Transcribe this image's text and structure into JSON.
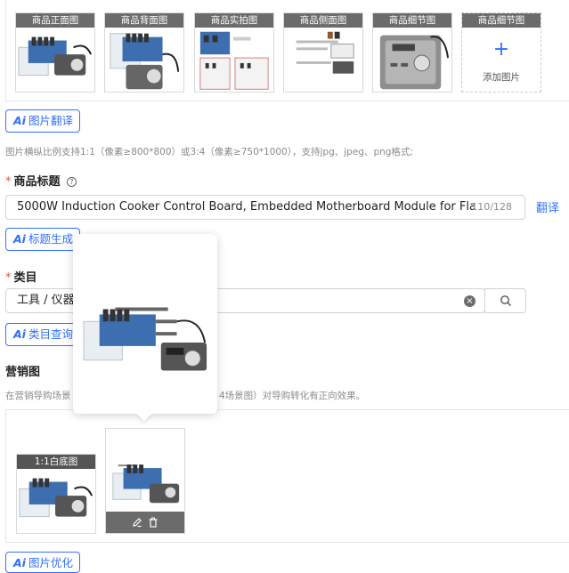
{
  "main_images": {
    "slots": [
      {
        "caption": "商品正面图"
      },
      {
        "caption": "商品背面图"
      },
      {
        "caption": "商品实拍图"
      },
      {
        "caption": "商品侧面图"
      },
      {
        "caption": "商品细节图"
      },
      {
        "caption": "商品细节图",
        "add_label": "添加图片",
        "add_symbol": "+"
      }
    ]
  },
  "image_translate": {
    "ai_mark": "Ai",
    "label": "图片翻译"
  },
  "image_hint": "图片横纵比例支持1:1（像素≥800*800）或3:4（像素≥750*1000），支持jpg、jpeg、png格式;",
  "title_field": {
    "required_mark": "*",
    "label": "商品标题",
    "help_icon": "?",
    "value": "5000W Induction Cooker Control Board, Embedded Motherboard Module for Flat & Concave",
    "counter": "110/128",
    "translate_link": "翻译"
  },
  "title_generate": {
    "ai_mark": "Ai",
    "label": "标题生成"
  },
  "category_field": {
    "required_mark": "*",
    "label": "类目",
    "value": "工具 / 仪器",
    "clear_icon": "×",
    "search_icon": "search-icon"
  },
  "category_query": {
    "ai_mark": "Ai",
    "label": "类目查询"
  },
  "marketing": {
    "label": "营销图",
    "hint_left": "在营销导购场景",
    "hint_right": "4场景图）对导购转化有正向效果。",
    "tile_caption": "1:1白底图",
    "edit_icon": "edit-icon",
    "delete_icon": "trash-icon"
  },
  "image_optimize": {
    "ai_mark": "Ai",
    "label": "图片优化"
  },
  "colors": {
    "accent": "#3370ff",
    "required": "#e34d59",
    "caption_bg": "#6b6b6b"
  }
}
